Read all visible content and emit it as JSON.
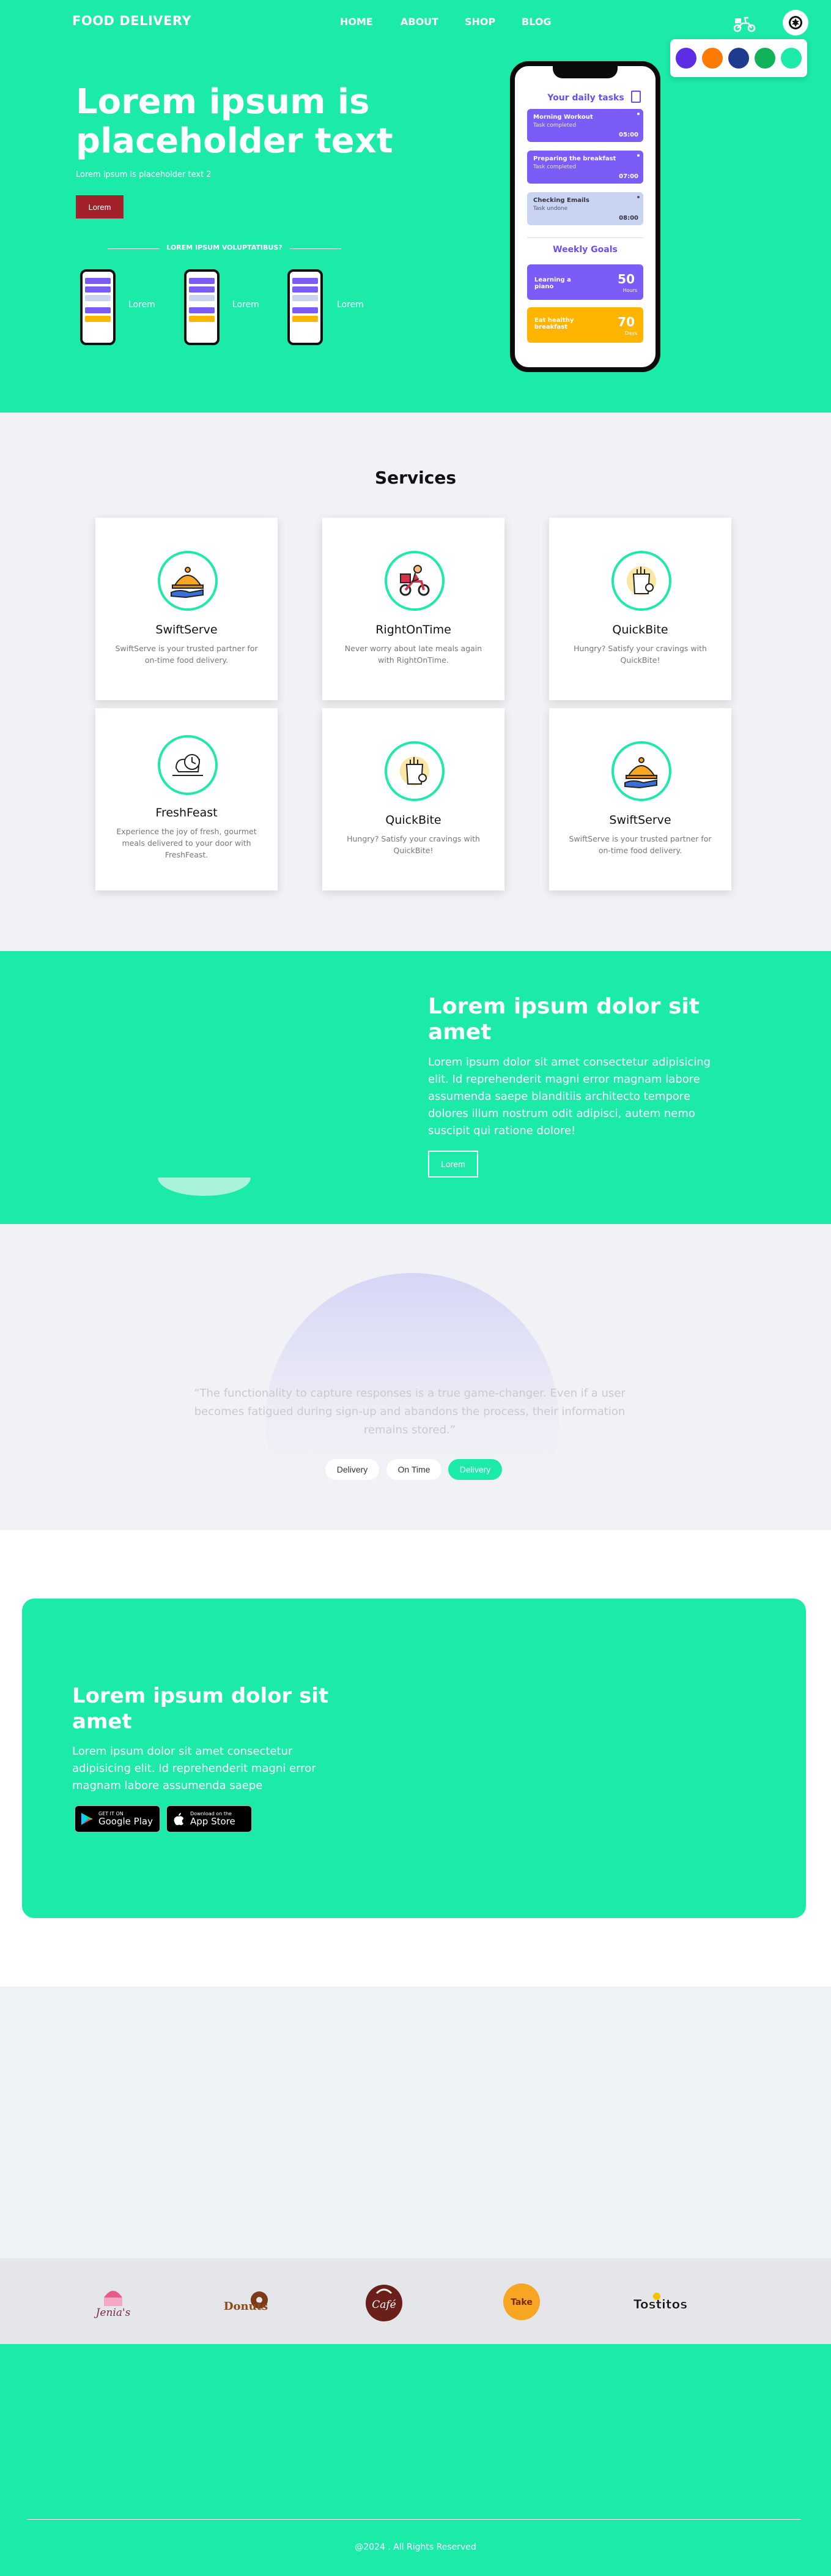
{
  "header": {
    "brand": "FOOD DELIVERY",
    "nav": [
      "HOME",
      "ABOUT",
      "SHOP",
      "BLOG"
    ],
    "icons": [
      "scooter-icon",
      "gear-icon"
    ],
    "palette": [
      "#5b2ee6",
      "#ff7a00",
      "#1f3b8f",
      "#10b35a",
      "#1ceaa8"
    ]
  },
  "hero": {
    "title": "Lorem ipsum is placeholder text",
    "subtitle": "Lorem ipsum is placeholder text 2",
    "button": "Lorem",
    "divider_text": "LOREM IPSUM VOLUPTATIBUS?",
    "mini_labels": [
      "Lorem",
      "Lorem",
      "Lorem"
    ]
  },
  "phone": {
    "title": "Your daily tasks",
    "tasks": [
      {
        "name": "Morning Workout",
        "status": "Task completed",
        "time": "05:00",
        "color": "#7b5cf6"
      },
      {
        "name": "Preparing the breakfast",
        "status": "Task completed",
        "time": "07:00",
        "color": "#7b5cf6"
      },
      {
        "name": "Checking Emails",
        "status": "Task undone",
        "time": "08:00",
        "color": "#c9d4f3"
      }
    ],
    "goals_title": "Weekly Goals",
    "goals": [
      {
        "label": "Learning a piano",
        "value": "50",
        "unit": "Hours",
        "color": "#7b5cf6"
      },
      {
        "label": "Eat healthy breakfast",
        "value": "70",
        "unit": "Days",
        "color": "#ffb400"
      }
    ]
  },
  "services": {
    "title": "Services",
    "cards": [
      {
        "name": "SwiftServe",
        "desc": "SwiftServe is your trusted partner for on-time food delivery.",
        "icon": "cloche-icon"
      },
      {
        "name": "RightOnTime",
        "desc": "Never worry about late meals again with RightOnTime.",
        "icon": "delivery-scooter-icon"
      },
      {
        "name": "QuickBite",
        "desc": "Hungry? Satisfy your cravings with QuickBite!",
        "icon": "food-bag-icon"
      },
      {
        "name": "FreshFeast",
        "desc": "Experience the joy of fresh, gourmet meals delivered to your door with FreshFeast.",
        "icon": "clock-bag-icon"
      },
      {
        "name": "QuickBite",
        "desc": "Hungry? Satisfy your cravings with QuickBite!",
        "icon": "food-bag-icon"
      },
      {
        "name": "SwiftServe",
        "desc": "SwiftServe is your trusted partner for on-time food delivery.",
        "icon": "cloche-icon"
      }
    ]
  },
  "promo": {
    "title": "Lorem ipsum dolor sit amet",
    "text": "Lorem ipsum dolor sit amet consectetur adipisicing elit. Id reprehenderit magni error magnam labore assumenda saepe blanditiis architecto tempore dolores illum nostrum odit adipisci, autem nemo suscipit qui ratione dolore!",
    "button": "Lorem"
  },
  "testimonial": {
    "quote": "“The functionality to capture responses is a true game-changer. Even if a user becomes fatigued during sign-up and abandons the process, their information remains stored.”",
    "tabs": [
      "Delivery",
      "On Time",
      "Delivery"
    ],
    "active_tab": 2
  },
  "app": {
    "title": "Lorem ipsum dolor sit amet",
    "text": "Lorem ipsum dolor sit amet consectetur adipisicing elit. Id reprehenderit magni error magnam labore assumenda saepe",
    "google": {
      "small": "GET IT ON",
      "big": "Google Play"
    },
    "apple": {
      "small": "Download on the",
      "big": "App Store"
    }
  },
  "logos": [
    {
      "name": "Jenia's",
      "text": "Jenia's"
    },
    {
      "name": "Donuts",
      "text": "Donuts"
    },
    {
      "name": "Café",
      "text": "Café"
    },
    {
      "name": "Restaurant Take",
      "text": "Take"
    },
    {
      "name": "Tostitos",
      "text": "Tostitos"
    }
  ],
  "footer": {
    "copyright": "@2024 . All Rights Reserved"
  }
}
